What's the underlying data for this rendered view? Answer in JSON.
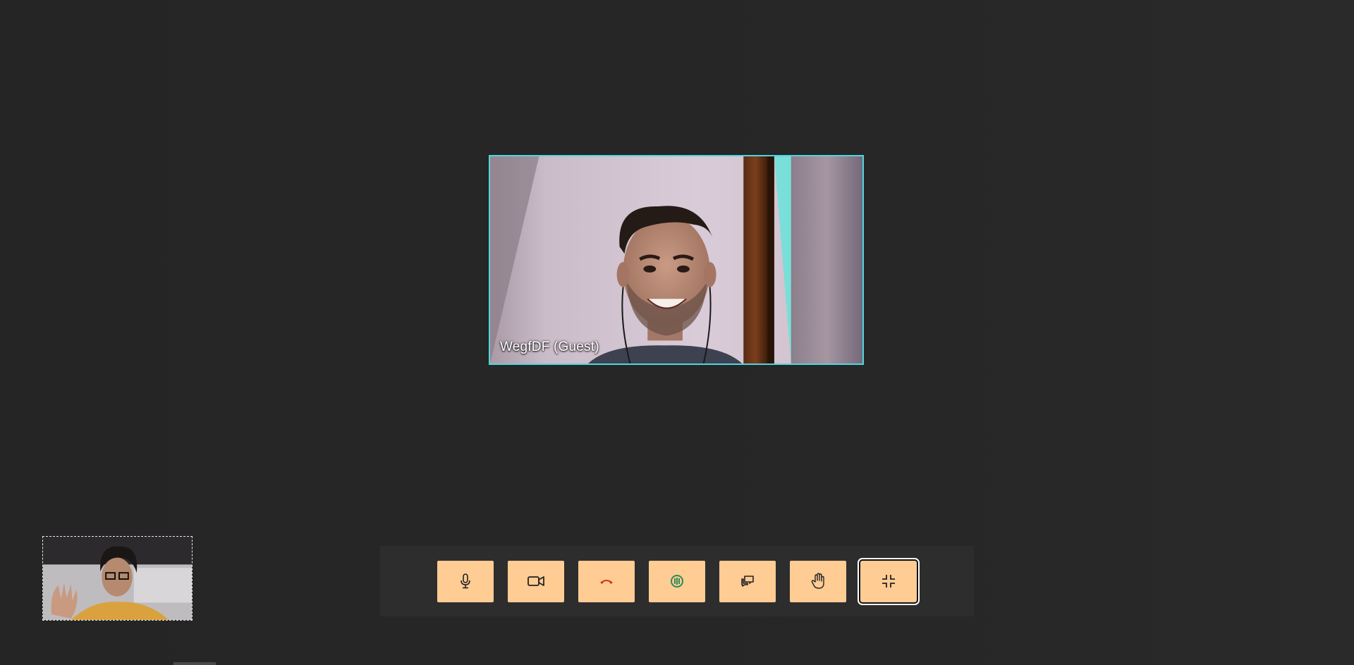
{
  "main_participant": {
    "name": "WegfDF (Guest)",
    "highlight_color": "#4fd6e0"
  },
  "controls": {
    "microphone": {
      "icon": "microphone-icon"
    },
    "camera": {
      "icon": "video-camera-icon"
    },
    "hang_up": {
      "icon": "phone-hangup-icon",
      "color": "#d32f2f"
    },
    "audio": {
      "icon": "sound-waves-icon",
      "color": "#2e8b57"
    },
    "chat": {
      "icon": "chat-bubbles-icon"
    },
    "raise_hand": {
      "icon": "raise-hand-icon"
    },
    "exit_fullscreen": {
      "icon": "exit-fullscreen-icon"
    }
  },
  "theme": {
    "background": "#262626",
    "control_bar": "#2d2d2d",
    "button_fill": "#ffcc94"
  }
}
